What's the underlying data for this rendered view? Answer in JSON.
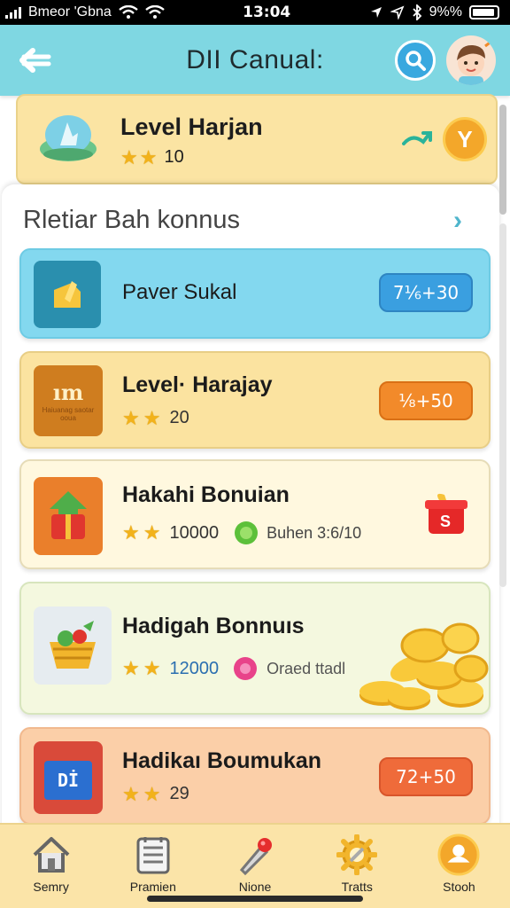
{
  "status_bar": {
    "carrier": "Bmeor 'Gbna",
    "time": "13:04",
    "battery": "9%%"
  },
  "header": {
    "title": "DII Canual:",
    "icons": [
      "back-arrow-icon",
      "search-icon",
      "avatar"
    ]
  },
  "level_card": {
    "title": "Level Harjan",
    "stars": 2,
    "value": "10",
    "badge": "Y",
    "icons": [
      "water-gem-icon",
      "swap-arrow-icon"
    ]
  },
  "section": {
    "title": "Rletiar Bah konnus"
  },
  "bonus_items": [
    {
      "title": "Paver Sukal",
      "pill": "7⅙+30",
      "pill_color": "#3a9fe0",
      "icon": "bag-icon"
    },
    {
      "title": "Level· Harajay",
      "stars": 2,
      "value": "20",
      "pill": "⅟₈+50",
      "pill_color": "#f28a2a",
      "icon": "level-crate-icon",
      "icon_text": "ım",
      "icon_subtext": "Haiuanag saotar ooua"
    },
    {
      "title": "Hakahi Bonuian",
      "stars": 2,
      "value": "10000",
      "extra": "Buhen 3:6/10",
      "icon": "gift-box-icon"
    },
    {
      "title": "Hadigah Bonnuıs",
      "stars": 2,
      "value": "12000",
      "extra": "Oraed ttadl",
      "icon": "fruit-basket-icon"
    },
    {
      "title": "Hadikaı Boumukan",
      "stars": 2,
      "value": "29",
      "pill": "72+50",
      "pill_color": "#ef6b3a",
      "icon": "calendar-box-icon",
      "icon_text": "Dİ"
    }
  ],
  "bottom_nav": [
    {
      "label": "Semry",
      "icon": "home-icon"
    },
    {
      "label": "Pramien",
      "icon": "list-icon"
    },
    {
      "label": "Nione",
      "icon": "pin-icon"
    },
    {
      "label": "Tratts",
      "icon": "gear-icon"
    },
    {
      "label": "Stooh",
      "icon": "profile-icon"
    }
  ]
}
